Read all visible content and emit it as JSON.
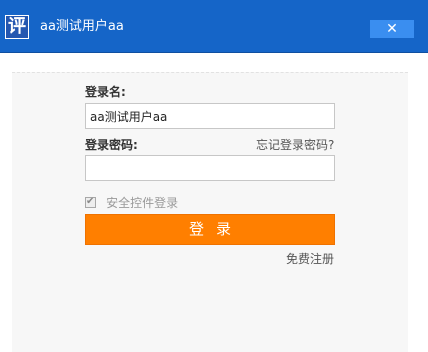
{
  "window": {
    "logo_char": "评",
    "title": "aa测试用户aa",
    "close_label": "✕"
  },
  "form": {
    "username_label": "登录名:",
    "username_value": "aa测试用户aa",
    "password_label": "登录密码:",
    "password_value": "",
    "forgot_link": "忘记登录密码?",
    "secure_checkbox_label": "安全控件登录",
    "secure_checkbox_checked": true,
    "login_button": "登录",
    "register_link": "免费注册"
  },
  "colors": {
    "titlebar": "#1565c8",
    "close_button": "#3a8ef0",
    "login_button": "#ff7f00",
    "panel_background": "#f7f7f7"
  }
}
